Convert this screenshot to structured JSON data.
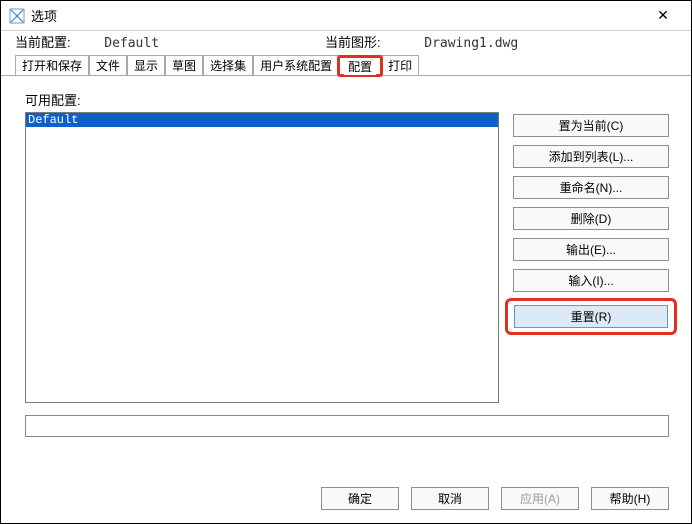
{
  "window": {
    "title": "选项",
    "close_glyph": "✕"
  },
  "header": {
    "current_profile_label": "当前配置:",
    "current_profile_value": "Default",
    "current_drawing_label": "当前图形:",
    "current_drawing_value": "Drawing1.dwg"
  },
  "tabs": [
    "打开和保存",
    "文件",
    "显示",
    "草图",
    "选择集",
    "用户系统配置",
    "配置",
    "打印"
  ],
  "active_tab_index": 6,
  "profiles": {
    "label": "可用配置:",
    "items": [
      "Default"
    ],
    "selected_index": 0
  },
  "side_buttons": {
    "set_current": "置为当前(C)",
    "add_to_list": "添加到列表(L)...",
    "rename": "重命名(N)...",
    "delete": "删除(D)",
    "export": "输出(E)...",
    "import": "输入(I)...",
    "reset": "重置(R)"
  },
  "footer": {
    "ok": "确定",
    "cancel": "取消",
    "apply": "应用(A)",
    "help": "帮助(H)"
  }
}
